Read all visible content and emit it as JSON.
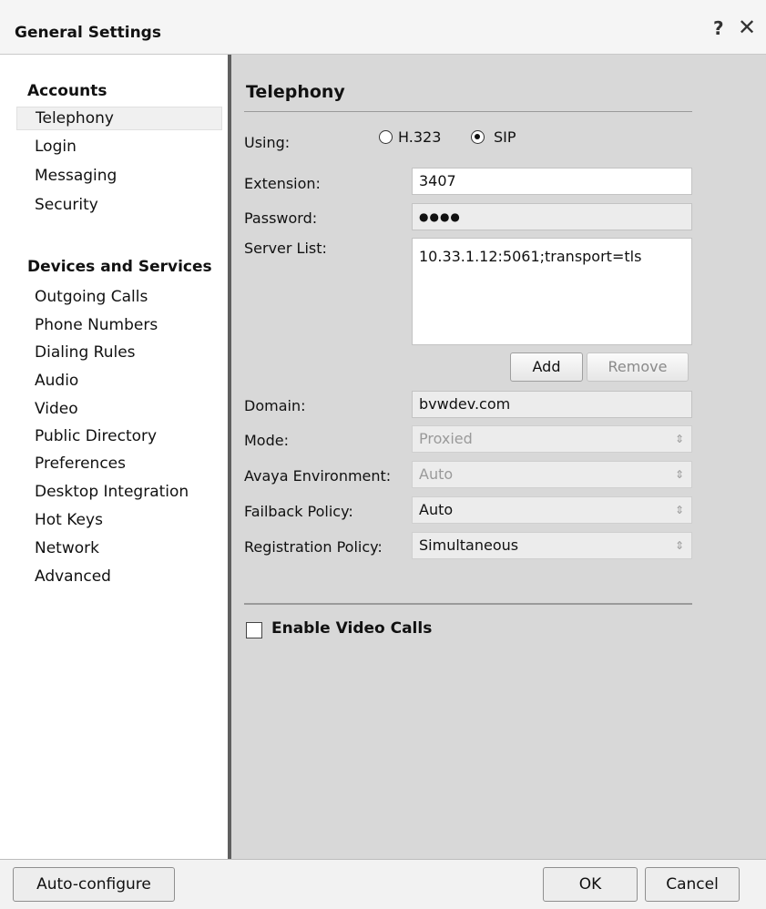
{
  "window": {
    "title": "General Settings",
    "help_glyph": "?",
    "close_glyph": "✕"
  },
  "sidebar": {
    "accounts_header": "Accounts",
    "accounts": [
      "Telephony",
      "Login",
      "Messaging",
      "Security"
    ],
    "devices_header": "Devices and Services",
    "devices": [
      "Outgoing Calls",
      "Phone Numbers",
      "Dialing Rules",
      "Audio",
      "Video",
      "Public Directory",
      "Preferences",
      "Desktop Integration",
      "Hot Keys",
      "Network",
      "Advanced"
    ],
    "selected": "Telephony"
  },
  "panel": {
    "title": "Telephony",
    "using": {
      "label": "Using:",
      "options": [
        "H.323",
        "SIP"
      ],
      "selected": "SIP"
    },
    "extension": {
      "label": "Extension:",
      "value": "3407"
    },
    "password": {
      "label": "Password:",
      "value": "●●●●"
    },
    "server_list": {
      "label": "Server List:",
      "value": "10.33.1.12:5061;transport=tls"
    },
    "add_button": "Add",
    "remove_button": "Remove",
    "domain": {
      "label": "Domain:",
      "value": "bvwdev.com"
    },
    "mode": {
      "label": "Mode:",
      "value": "Proxied",
      "disabled": true
    },
    "avaya_env": {
      "label": "Avaya Environment:",
      "value": "Auto",
      "disabled": true
    },
    "failback": {
      "label": "Failback Policy:",
      "value": "Auto"
    },
    "registration": {
      "label": "Registration Policy:",
      "value": "Simultaneous"
    },
    "enable_video": {
      "label": "Enable Video Calls",
      "checked": false
    }
  },
  "footer": {
    "auto_configure": "Auto-configure",
    "ok": "OK",
    "cancel": "Cancel"
  },
  "icons": {
    "help": "help-icon",
    "close": "close-icon",
    "select_arrow": "up-down-arrow-icon"
  }
}
